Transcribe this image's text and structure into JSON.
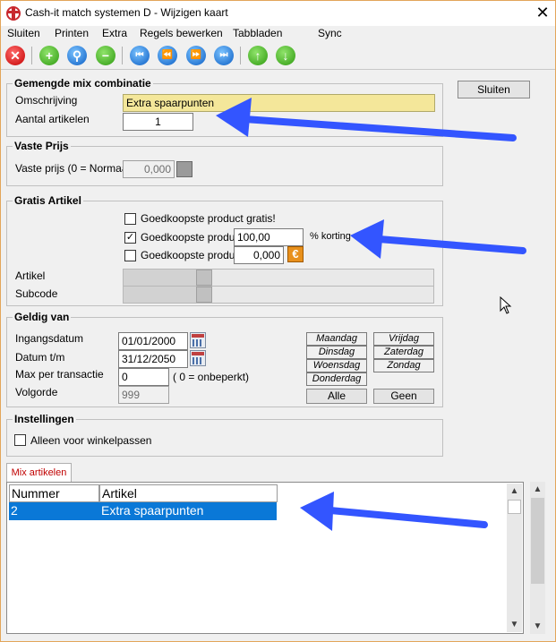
{
  "window": {
    "title": "Cash-it match systemen D - Wijzigen kaart",
    "close_glyph": "✕"
  },
  "menu": [
    "Sluiten",
    "Printen",
    "Extra",
    "Regels bewerken",
    "Tabbladen",
    "Sync"
  ],
  "toolbar": {
    "delete": "✕",
    "add": "+",
    "search": "⚲",
    "remove": "−",
    "first": "⏮",
    "prev": "⏪",
    "next": "⏩",
    "last": "⏭",
    "up": "↑",
    "down": "↓"
  },
  "gemengde": {
    "title": "Gemengde mix combinatie",
    "omschrijving_label": "Omschrijving",
    "omschrijving_value": "Extra spaarpunten",
    "aantal_label": "Aantal artikelen",
    "aantal_value": "1"
  },
  "sluiten_button": "Sluiten",
  "vaste": {
    "title": "Vaste Prijs",
    "label": "Vaste prijs (0 = Normaal)",
    "value": "0,000"
  },
  "gratis": {
    "title": "Gratis Artikel",
    "check1_label": "Goedkoopste product gratis!",
    "check1_checked": "",
    "check2_label": "Goedkoopste product",
    "check2_checked": "✓",
    "check2_value": "100,00",
    "check2_unit": "% korting",
    "check3_label": "Goedkoopste product",
    "check3_checked": "",
    "check3_value": "0,000",
    "euro_glyph": "€",
    "artikel_label": "Artikel",
    "subcode_label": "Subcode"
  },
  "geldig": {
    "title": "Geldig van",
    "ingang_label": "Ingangsdatum",
    "ingang_value": "01/01/2000",
    "datum_label": "Datum t/m",
    "datum_value": "31/12/2050",
    "max_label": "Max per transactie",
    "max_value": "0",
    "max_hint": "( 0 = onbeperkt)",
    "volgorde_label": "Volgorde",
    "volgorde_value": "999",
    "days": [
      "Maandag",
      "Dinsdag",
      "Woensdag",
      "Donderdag",
      "Vrijdag",
      "Zaterdag",
      "Zondag"
    ],
    "alle_button": "Alle",
    "geen_button": "Geen"
  },
  "instellingen": {
    "title": "Instellingen",
    "check_label": "Alleen voor winkelpassen",
    "check_checked": ""
  },
  "mix": {
    "tab_label": "Mix artikelen",
    "columns": [
      "Nummer",
      "Artikel"
    ],
    "rows": [
      {
        "nummer": "2",
        "artikel": "Extra spaarpunten"
      }
    ],
    "scroll_up": "▲",
    "scroll_down": "▼"
  },
  "colors": {
    "arrow": "#3355ff",
    "selection": "#0a78d7",
    "highlight_field": "#f4e79a"
  }
}
